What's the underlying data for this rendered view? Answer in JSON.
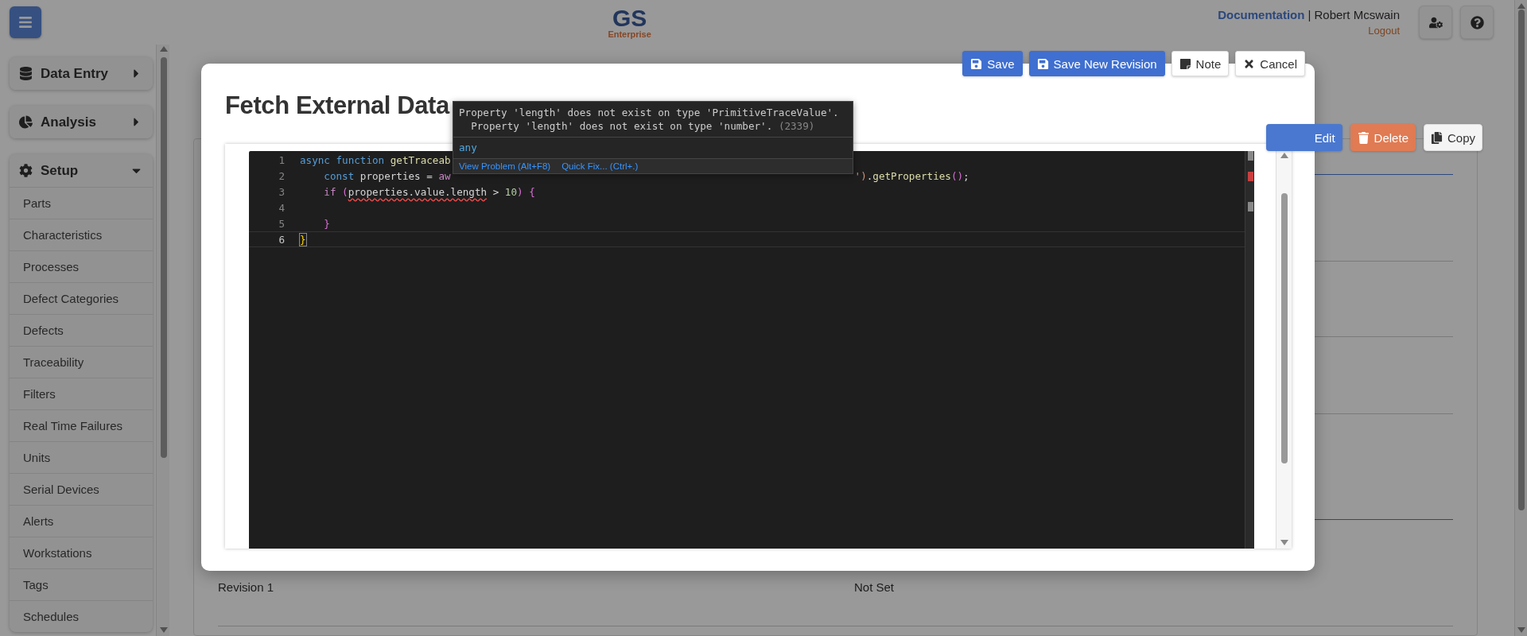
{
  "header": {
    "logo_title": "GS",
    "logo_subtitle": "Enterprise",
    "link": "Documentation",
    "user": "| Robert Mcswain",
    "logout": "Logout"
  },
  "sidebar": {
    "sections": [
      {
        "label": "Data Entry",
        "kind": "data",
        "expanded": false
      },
      {
        "label": "Analysis",
        "kind": "analysis",
        "expanded": false
      },
      {
        "label": "Setup",
        "kind": "setup",
        "expanded": true,
        "items": [
          "Parts",
          "Characteristics",
          "Processes",
          "Defect Categories",
          "Defects",
          "Traceability",
          "Filters",
          "Real Time Failures",
          "Units",
          "Serial Devices",
          "Alerts",
          "Workstations",
          "Tags",
          "Schedules"
        ]
      }
    ]
  },
  "page": {
    "actions": [
      {
        "label": "Edit",
        "kind": "primary"
      },
      {
        "label": "Delete",
        "kind": "danger"
      },
      {
        "label": "Copy",
        "kind": "plain"
      }
    ],
    "fields": [
      "Revision 1",
      "Not Set"
    ]
  },
  "modal": {
    "title": "Fetch External Data",
    "buttons": [
      {
        "label": "Save",
        "kind": "save"
      },
      {
        "label": "Save New Revision",
        "kind": "save"
      },
      {
        "label": "Note",
        "kind": "note"
      },
      {
        "label": "Cancel",
        "kind": "cancel"
      }
    ],
    "editor": {
      "lines": [
        {
          "number": "1",
          "current": false,
          "left": [
            {
              "text": "async function ",
              "kind": "keyword"
            },
            {
              "text": "getTraceab",
              "kind": "function"
            }
          ]
        },
        {
          "number": "2",
          "current": false,
          "left": [
            {
              "text": "    const ",
              "kind": "keyword"
            },
            {
              "text": "properties = ",
              "kind": "plain"
            },
            {
              "text": "aw",
              "kind": "control"
            }
          ],
          "right": [
            {
              "text": "')",
              "kind": "string"
            },
            {
              "text": ".",
              "kind": "plain"
            },
            {
              "text": "getProperties",
              "kind": "function"
            },
            {
              "text": "()",
              "kind": "bracket"
            },
            {
              "text": ";",
              "kind": "plain"
            }
          ]
        },
        {
          "number": "3",
          "current": false,
          "left": [
            {
              "text": "    if ",
              "kind": "control"
            },
            {
              "text": "(",
              "kind": "bracket"
            },
            {
              "text": "properties.value.length",
              "kind": "error"
            },
            {
              "text": " > ",
              "kind": "plain"
            },
            {
              "text": "10",
              "kind": "number"
            },
            {
              "text": ")",
              "kind": "bracket"
            },
            {
              "text": " {",
              "kind": "bracket"
            }
          ]
        },
        {
          "number": "4",
          "current": false
        },
        {
          "number": "5",
          "current": false,
          "left": [
            {
              "text": "    }",
              "kind": "bracket"
            }
          ]
        },
        {
          "number": "6",
          "current": true,
          "left": [
            {
              "text": "}",
              "kind": "match"
            }
          ]
        }
      ]
    },
    "hover": {
      "messages": [
        "Property 'length' does not exist on type 'PrimitiveTraceValue'.",
        "  Property 'length' does not exist on type 'number'."
      ],
      "code": "(2339)",
      "type": "any",
      "actions": [
        "View Problem (Alt+F8)",
        "Quick Fix... (Ctrl+.)"
      ]
    }
  }
}
